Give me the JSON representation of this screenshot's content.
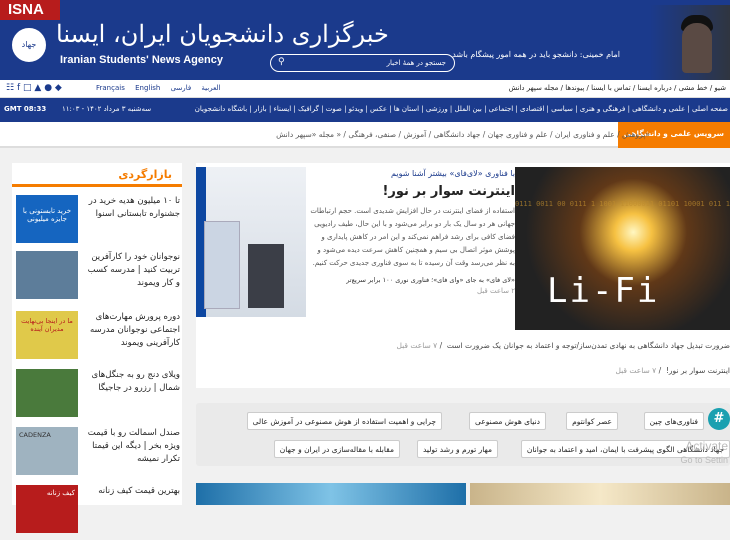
{
  "header": {
    "brand_tab": "ISNA",
    "logo_badge": "جهاد",
    "title_fa": "خبرگزاری دانشجویان ایران، ایسنا",
    "title_en": "Iranian Students' News Agency",
    "slogan": "امام خمینی: دانشجو باید در همه امور پیشگام باشد",
    "search_placeholder": "جستجو در همهٔ اخبار",
    "search_icon": "search-icon"
  },
  "topbar": {
    "social_icons": [
      "rss-icon",
      "facebook-icon",
      "instagram-icon",
      "twitter-icon",
      "android-icon",
      "apple-icon"
    ],
    "languages": [
      "Français",
      "English",
      "العربیة",
      "فارسی"
    ],
    "links": "شیو / خط مشی / درباره ایسنا / تماس با ایسنا / پیوندها / مجله سپهر دانش"
  },
  "navbar": {
    "gmt": "GMT 08:33",
    "date": "سه‌شنبه ۳ مرداد ۱۴۰۲ - ۱۱:۰۳",
    "menu": "صفحه اصلی | علمی و دانشگاهی | فرهنگی و هنری | سیاسی | اقتصادی | اجتماعی | بین الملل | ورزشی | استان ها | عکس | ویدئو | صوت | گرافیک | ایسناء | بازار | باشگاه دانشجویان"
  },
  "subnav": {
    "active": "سرویس علمی و دانشگاهی",
    "items": "پژوهش / علم و فناوری ایران / علم و فناوری جهان / جهاد دانشگاهی / آموزش / صنفی، فرهنگی / « مجله «سپهر دانش»"
  },
  "sidebar": {
    "heading": "بازارگردی",
    "ads": [
      {
        "text": "تا ۱۰ میلیون هدیه خرید در جشنواره تابستانی اسنوا",
        "thumb": "خرید تابستونی با جایزه میلیونی",
        "color": "#1565c0"
      },
      {
        "text": "نوجوانان خود را کارآفرین تربیت کنید | مدرسه کسب و کار ویموند",
        "thumb": "",
        "color": "#5d7d9a"
      },
      {
        "text": "دوره پرورش مهارت‌های اجتماعی نوجوانان مدرسه کارآفرینی ویموند",
        "thumb": "ما در اینجا بی‌نهایت مدیران آینده",
        "color": "#e0c94a"
      },
      {
        "text": "ویلای دنج رو به جنگل‌های شمال | رزرو در جاجیگا",
        "thumb": "",
        "color": "#4a7a3c"
      },
      {
        "text": "صندل اسمالت رو با قیمت ویژه بخر | دیگه این قیمتا تکرار نمیشه",
        "thumb": "CADENZA",
        "color": "#9fb3c0"
      },
      {
        "text": "بهترین قیمت کیف زنانه",
        "thumb": "کیف زنانه",
        "color": "#b71c1c"
      }
    ]
  },
  "feature": {
    "kicker": "با فناوری «لای‌فای» بیشتر آشنا شویم",
    "title": "اینترنت سوار بر نور!",
    "lead": "استفاده از فضای اینترنت در حال افزایش شدیدی است. حجم ارتباطات جهانی هر دو سال یک بار دو برابر می‌شود و با این حال، طیف رادیویی فضای کافی برای رشد فراهم نمی‌کند و این امر در کاهش پایداری و پوشش موثر اتصال بی سیم و همچنین کاهش سرعت دیده می‌شود و به نظر می‌رسد وقت آن رسیده تا به سوی فناوری جدیدی حرکت کنیم.",
    "bullet": "«لای فای» به جای «وای فای»؛ فناوری نوری ۱۰۰ برابر سریع‌تر",
    "time": "۲ ساعت قبل",
    "image_text": "Li-Fi",
    "bits": "0111 0011 00 0111 1 1001 11000011 01101 10001 011 11 001 0101 1 1010 001 1101 1100 01011 0011 01011 1001 1 01 1 1 001 0 001 11 0001"
  },
  "more_news": [
    {
      "text": "ضرورت تبدیل جهاد دانشگاهی به نهادی تمدن‌ساز/توجه و اعتماد به جوانان یک ضرورت است",
      "time": "۷ ساعت قبل"
    },
    {
      "text": "اینترنت سوار بر نور!",
      "time": "۷ ساعت قبل"
    }
  ],
  "tags": {
    "row1": [
      "فناوری‌های چین",
      "عصر کوانتوم",
      "دنیای هوش مصنوعی",
      "چرایی و اهمیت استفاده از هوش مصنوعی در آموزش عالی"
    ],
    "row2": [
      "جهاد دانشگاهی الگوی پیشرفت با ایمان، امید و اعتماد به جوانان",
      "مهار تورم و رشد تولید",
      "مقابله با مقاله‌سازی در ایران و جهان"
    ]
  },
  "watermark": {
    "line1": "Activate",
    "line2": "Go to Settin"
  }
}
